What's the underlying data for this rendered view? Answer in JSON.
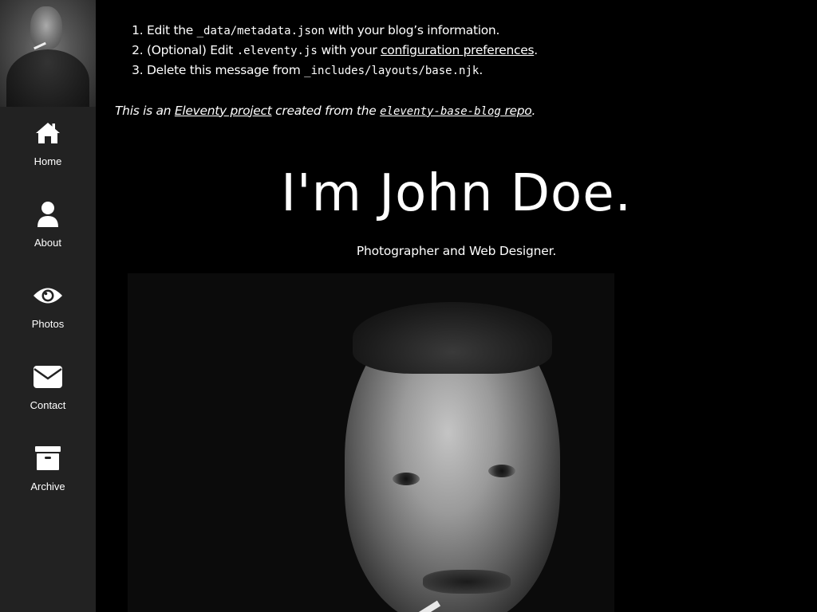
{
  "sidebar": {
    "items": [
      {
        "label": "Home",
        "icon": "home-icon"
      },
      {
        "label": "About",
        "icon": "user-icon"
      },
      {
        "label": "Photos",
        "icon": "eye-icon"
      },
      {
        "label": "Contact",
        "icon": "envelope-icon"
      },
      {
        "label": "Archive",
        "icon": "archive-icon"
      }
    ]
  },
  "steps": [
    {
      "prefix": "Edit the ",
      "code": "_data/metadata.json",
      "suffix": " with your blog’s information."
    },
    {
      "prefix": "(Optional) Edit ",
      "code": ".eleventy.js",
      "middle": " with your ",
      "link": "configuration preferences",
      "suffix": "."
    },
    {
      "prefix": "Delete this message from ",
      "code": "_includes/layouts/base.njk",
      "suffix": "."
    }
  ],
  "note": {
    "prefix": "This is an ",
    "link1": "Eleventy project",
    "middle": " created from the ",
    "link2_code": "eleventy-base-blog",
    "link2_text": " repo",
    "suffix": "."
  },
  "hero": {
    "title": "I'm John Doe.",
    "subtitle": "Photographer and Web Designer."
  },
  "colors": {
    "sidebar_bg": "#222222",
    "page_bg": "#000000",
    "text": "#ffffff"
  }
}
